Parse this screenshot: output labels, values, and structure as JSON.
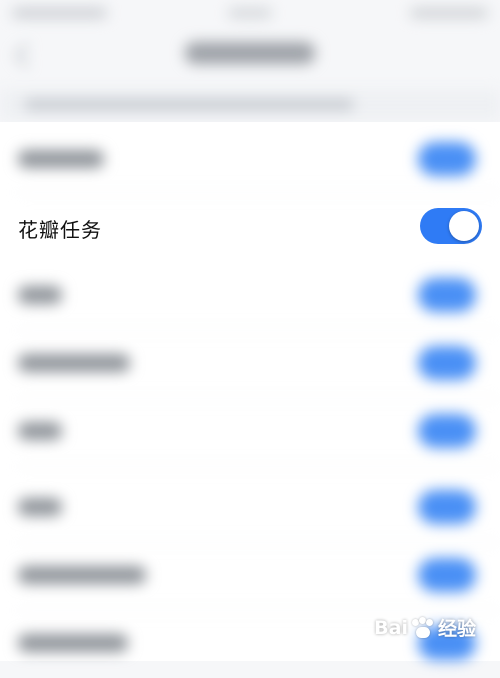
{
  "item": {
    "label": "花瓣任务",
    "toggle_on": true
  },
  "colors": {
    "accent": "#2f7bf5",
    "background": "#f6f7f9"
  },
  "watermark": {
    "brand_left": "Bai",
    "brand_right": "经验",
    "icon": "paw-icon"
  }
}
